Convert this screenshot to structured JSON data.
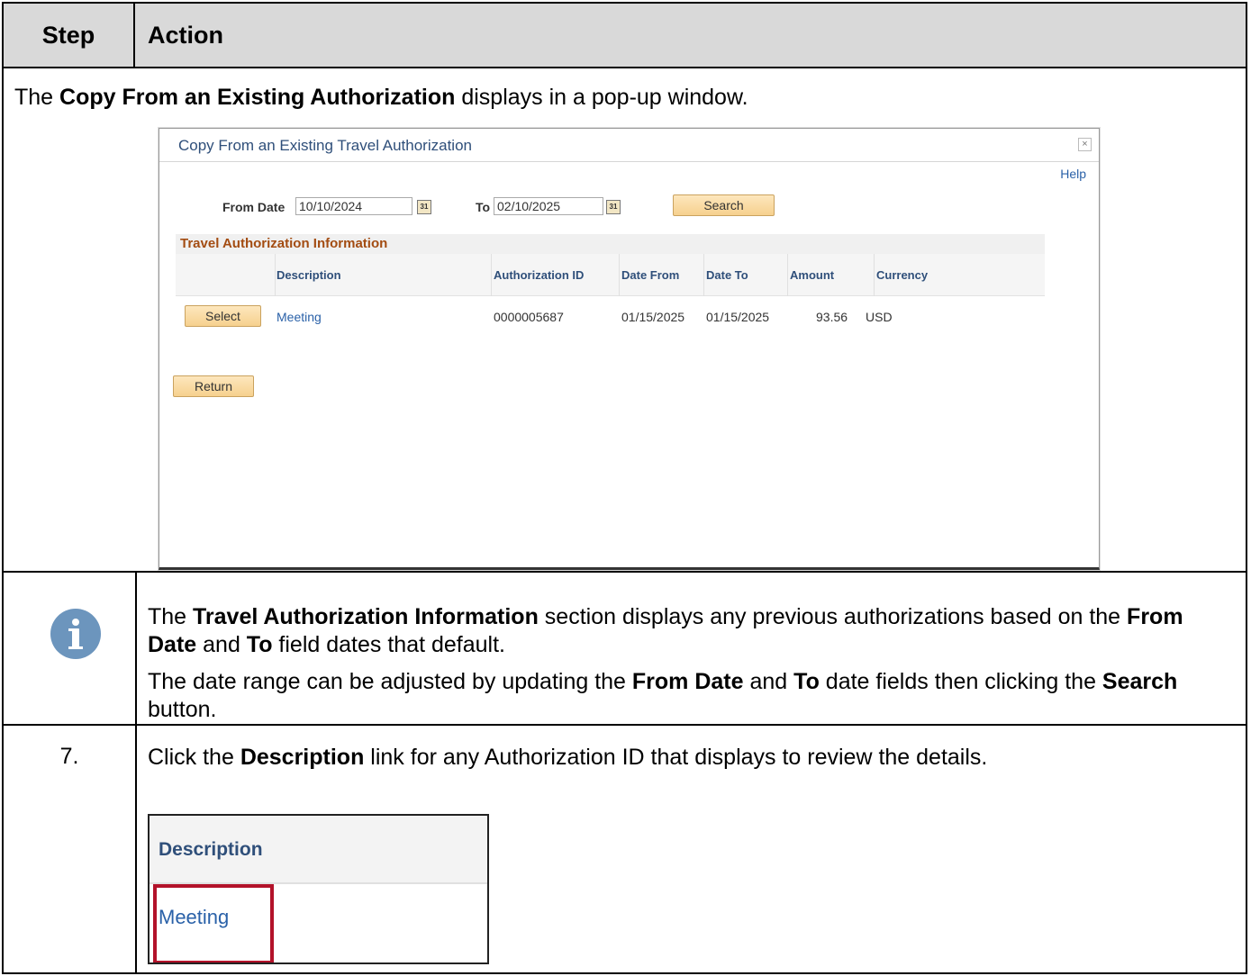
{
  "table": {
    "header": {
      "step": "Step",
      "action": "Action"
    },
    "row1": {
      "intro": {
        "prefix": "The ",
        "bold": "Copy From an Existing Authorization",
        "suffix": " displays in a pop-up window."
      }
    },
    "row2": {
      "icon": "info-icon",
      "p1": {
        "a": "The ",
        "b": "Travel Authorization Information",
        "c": " section displays any previous authorizations based on the ",
        "d": "From Date",
        "e": " and ",
        "f": "To",
        "g": " field dates that default."
      },
      "p2": {
        "a": "The date range can be adjusted by updating the ",
        "b": "From Date",
        "c": " and ",
        "d": "To",
        "e": " date fields then clicking the ",
        "f": "Search",
        "g": " button."
      }
    },
    "row3": {
      "step": "7.",
      "p": {
        "a": "Click the ",
        "b": "Description",
        "c": " link for any Authorization ID that displays to review the details."
      },
      "crop": {
        "header": "Description",
        "link": "Meeting"
      }
    }
  },
  "popup": {
    "title": "Copy From an Existing Travel Authorization",
    "close": "×",
    "help": "Help",
    "from_label": "From Date",
    "from_value": "10/10/2024",
    "to_label": "To",
    "to_value": "02/10/2025",
    "cal_glyph": "31",
    "search": "Search",
    "section": "Travel Authorization Information",
    "columns": [
      "Description",
      "Authorization ID",
      "Date From",
      "Date To",
      "Amount",
      "Currency"
    ],
    "row": {
      "select": "Select",
      "description": "Meeting",
      "auth_id": "0000005687",
      "date_from": "01/15/2025",
      "date_to": "01/15/2025",
      "amount": "93.56",
      "currency": "USD"
    },
    "return": "Return"
  },
  "colors": {
    "highlight": "#b3122a",
    "link": "#2a61a8",
    "header_bg": "#d9d9d9"
  }
}
